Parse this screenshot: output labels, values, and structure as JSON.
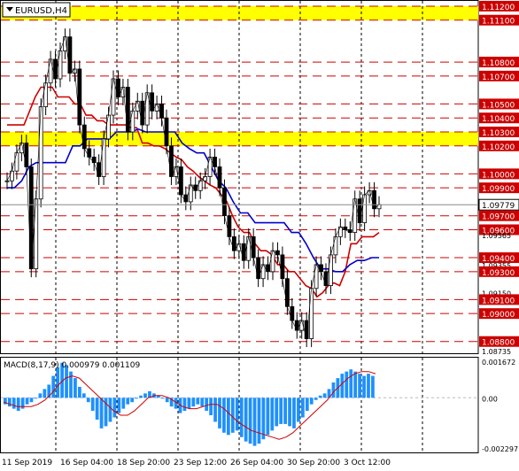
{
  "symbol_label": "EURUSD,H4",
  "macd_label": "MACD(8,17,9) 0.000979 0.001109",
  "chart_data": [
    {
      "type": "candlestick",
      "title": "EURUSD,H4",
      "ylim": [
        1.08735,
        1.11225
      ],
      "price_labels": [
        {
          "value": 1.112,
          "text": "1.11200",
          "style": "red"
        },
        {
          "value": 1.111,
          "text": "1.11100",
          "style": "red"
        },
        {
          "value": 1.108,
          "text": "1.10800",
          "style": "red"
        },
        {
          "value": 1.107,
          "text": "1.10700",
          "style": "red"
        },
        {
          "value": 1.105,
          "text": "1.10500",
          "style": "red"
        },
        {
          "value": 1.104,
          "text": "1.10400",
          "style": "red"
        },
        {
          "value": 1.103,
          "text": "1.10300",
          "style": "red"
        },
        {
          "value": 1.102,
          "text": "1.10200",
          "style": "red"
        },
        {
          "value": 1.1,
          "text": "1.10000",
          "style": "red"
        },
        {
          "value": 1.099,
          "text": "1.09900",
          "style": "red"
        },
        {
          "value": 1.09779,
          "text": "1.09779",
          "style": "current"
        },
        {
          "value": 1.097,
          "text": "1.09700",
          "style": "red"
        },
        {
          "value": 1.096,
          "text": "1.09600",
          "style": "red"
        },
        {
          "value": 1.09565,
          "text": "1.09565",
          "style": "plain"
        },
        {
          "value": 1.094,
          "text": "1.09400",
          "style": "red"
        },
        {
          "value": 1.0935,
          "text": "1.09355",
          "style": "plain"
        },
        {
          "value": 1.093,
          "text": "1.09300",
          "style": "red"
        },
        {
          "value": 1.0915,
          "text": "1.09150",
          "style": "plain"
        },
        {
          "value": 1.091,
          "text": "1.09100",
          "style": "red"
        },
        {
          "value": 1.09,
          "text": "1.09000",
          "style": "red"
        },
        {
          "value": 1.088,
          "text": "1.08800",
          "style": "red"
        },
        {
          "value": 1.08735,
          "text": "1.08735",
          "style": "plain"
        }
      ],
      "resistance_levels": [
        1.112,
        1.111,
        1.108,
        1.107,
        1.105,
        1.104,
        1.103,
        1.102,
        1.1,
        1.099,
        1.097,
        1.096,
        1.094,
        1.093,
        1.091,
        1.09,
        1.088
      ],
      "yellow_zones": [
        [
          1.111,
          1.112
        ],
        [
          1.102,
          1.103
        ]
      ],
      "x_labels": [
        "11 Sep 2019",
        "16 Sep 04:00",
        "18 Sep 20:00",
        "23 Sep 12:00",
        "26 Sep 04:00",
        "30 Sep 20:00",
        "3 Oct 12:00"
      ],
      "series": [
        {
          "name": "price",
          "color": "#000000",
          "values": [
            1.0995,
            1.1002,
            1.1015,
            1.1022,
            1.1005,
            1.0932,
            1.0982,
            1.1048,
            1.1065,
            1.1082,
            1.1068,
            1.1088,
            1.1098,
            1.1072,
            1.1075,
            1.1035,
            1.1018,
            1.1012,
            1.1008,
            1.0998,
            1.1025,
            1.1042,
            1.1068,
            1.1055,
            1.1062,
            1.103,
            1.1045,
            1.1052,
            1.1035,
            1.1058,
            1.1045,
            1.105,
            1.104,
            1.102,
            1.0998,
            1.1005,
            1.0985,
            1.098,
            1.0992,
            1.0988,
            1.0995,
            1.0998,
            1.1012,
            1.1005,
            1.099,
            1.097,
            1.0955,
            1.0945,
            1.095,
            1.0938,
            1.0955,
            1.094,
            1.0925,
            1.0935,
            1.093,
            1.0945,
            1.0942,
            1.0925,
            1.0905,
            1.0895,
            1.0888,
            1.0895,
            1.0882,
            1.0918,
            1.0935,
            1.093,
            1.092,
            1.0942,
            1.0955,
            1.0962,
            1.096,
            1.0958,
            1.0982,
            1.0965,
            1.0985,
            1.0988,
            1.0975,
            1.0978
          ]
        },
        {
          "name": "kijun",
          "color": "#cc0000",
          "values": [
            1.1035,
            1.1035,
            1.1035,
            1.1035,
            1.1045,
            1.1055,
            1.1062,
            1.1062,
            1.1062,
            1.1055,
            1.1055,
            1.1055,
            1.105,
            1.105,
            1.1042,
            1.1042,
            1.1038,
            1.1038,
            1.1035,
            1.1035,
            1.1035,
            1.1035,
            1.1033,
            1.1033,
            1.1022,
            1.1022,
            1.102,
            1.102,
            1.1018,
            1.1015,
            1.1012,
            1.101,
            1.1005,
            1.1002,
            1.0998,
            1.0995,
            1.0992,
            1.099,
            1.0985,
            1.098,
            1.097,
            1.0962,
            1.0958,
            1.0958,
            1.095,
            1.0945,
            1.0945,
            1.0942,
            1.0935,
            1.0935,
            1.093,
            1.093,
            1.0925,
            1.092,
            1.0918,
            1.0912,
            1.0915,
            1.092,
            1.0922,
            1.092,
            1.093,
            1.095,
            1.095,
            1.0955,
            1.0955,
            1.0955,
            1.0958
          ]
        },
        {
          "name": "tenkan",
          "color": "#0000cc",
          "values": [
            1.099,
            1.099,
            1.0995,
            1.1005,
            1.1008,
            1.1008,
            1.1008,
            1.1008,
            1.1008,
            1.102,
            1.102,
            1.1025,
            1.1025,
            1.1025,
            1.1025,
            1.103,
            1.103,
            1.103,
            1.1032,
            1.103,
            1.103,
            1.103,
            1.103,
            1.103,
            1.1022,
            1.1018,
            1.1015,
            1.1015,
            1.1005,
            1.0995,
            1.099,
            1.098,
            1.0972,
            1.0972,
            1.0965,
            1.0965,
            1.0965,
            1.0965,
            1.0965,
            1.0958,
            1.0958,
            1.095,
            1.094,
            1.0932,
            1.0932,
            1.093,
            1.093,
            1.0935,
            1.0938,
            1.0938,
            1.094,
            1.094
          ]
        }
      ]
    },
    {
      "type": "bar",
      "title": "MACD(8,17,9) 0.000979 0.001109",
      "ylim": [
        -0.002297,
        0.001672
      ],
      "tick_labels": [
        {
          "value": 0.001672,
          "text": "0.001672"
        },
        {
          "value": 0.0,
          "text": "0.00"
        },
        {
          "value": -0.002297,
          "text": "-0.002297"
        }
      ],
      "series": [
        {
          "name": "histogram",
          "color": "#1e90ff",
          "values": [
            -0.0003,
            -0.0004,
            -0.0005,
            -0.0006,
            -0.0005,
            -0.0003,
            -0.0002,
            0.0,
            0.0002,
            0.0004,
            0.0006,
            0.001,
            0.0014,
            0.0016,
            0.0015,
            0.0012,
            0.0009,
            0.0005,
            0.0002,
            -0.0002,
            -0.0006,
            -0.001,
            -0.0014,
            -0.0013,
            -0.0011,
            -0.0009,
            -0.0007,
            -0.0005,
            -0.0003,
            -0.0002,
            0.0,
            0.0001,
            0.0002,
            0.0003,
            0.0002,
            0.0001,
            0.0,
            -0.0002,
            -0.0004,
            -0.0005,
            -0.0007,
            -0.0006,
            -0.0005,
            -0.0004,
            -0.0003,
            -0.0004,
            -0.0006,
            -0.0008,
            -0.0011,
            -0.0014,
            -0.0016,
            -0.0017,
            -0.0016,
            -0.0015,
            -0.0018,
            -0.002,
            -0.0021,
            -0.0022,
            -0.0021,
            -0.0019,
            -0.0017,
            -0.0015,
            -0.0013,
            -0.0012,
            -0.0012,
            -0.0013,
            -0.0014,
            -0.0011,
            -0.0009,
            -0.0006,
            -0.0003,
            -0.0001,
            0.0001,
            0.0002,
            0.0004,
            0.0007,
            0.0009,
            0.0011,
            0.0012,
            0.0013,
            0.0012,
            0.0011,
            0.001,
            0.0011,
            0.001
          ]
        },
        {
          "name": "signal",
          "color": "#cc0000",
          "values": [
            -0.0002,
            -0.0003,
            -0.0004,
            -0.0004,
            -0.0004,
            -0.0003,
            -0.0001,
            0.0002,
            0.0006,
            0.0009,
            0.001,
            0.0009,
            0.0006,
            0.0003,
            0.0,
            -0.0003,
            -0.0006,
            -0.0008,
            -0.0008,
            -0.0006,
            -0.0003,
            0.0,
            0.0001,
            0.0001,
            0.0,
            -0.0002,
            -0.0004,
            -0.0005,
            -0.0005,
            -0.0004,
            -0.0003,
            -0.0003,
            -0.0005,
            -0.0008,
            -0.0011,
            -0.0013,
            -0.0015,
            -0.0016,
            -0.0017,
            -0.0018,
            -0.0019,
            -0.0018,
            -0.0016,
            -0.0013,
            -0.001,
            -0.0007,
            -0.0004,
            -0.0001,
            0.0003,
            0.0006,
            0.0009,
            0.0011,
            0.0012,
            0.0012,
            0.0011
          ]
        }
      ]
    }
  ]
}
